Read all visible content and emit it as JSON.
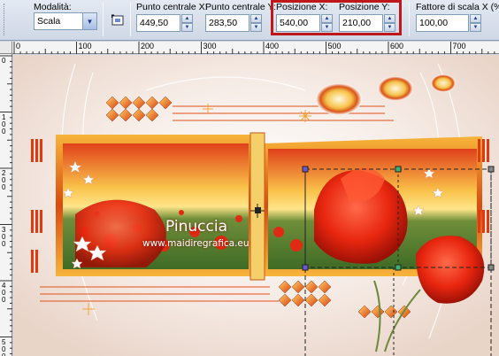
{
  "toolbar": {
    "modalita_label": "Modalità:",
    "modalita_value": "Scala",
    "punto_x_label": "Punto centrale X:",
    "punto_x_value": "449,50",
    "punto_y_label": "Punto centrale Y:",
    "punto_y_value": "283,50",
    "pos_x_label": "Posizione X:",
    "pos_x_value": "540,00",
    "pos_y_label": "Posizione Y:",
    "pos_y_value": "210,00",
    "scala_x_label": "Fattore di scala X (%):",
    "scala_x_value": "100,00",
    "highlight_color": "#c0181a"
  },
  "ruler": {
    "top_labels": [
      "0",
      "100",
      "200",
      "300",
      "400",
      "500",
      "600",
      "700"
    ],
    "left_labels": [
      "0",
      "1\n0\n0",
      "2\n0\n0",
      "3\n0\n0",
      "4\n0\n0",
      "5\n0\n0"
    ]
  },
  "canvas": {
    "title_text": "Pinuccia",
    "url_text": "www.maidiregrafica.eu"
  },
  "colors": {
    "accent_red": "#d93a10",
    "accent_orange": "#f08a1c",
    "gold": "#f4c14a"
  }
}
